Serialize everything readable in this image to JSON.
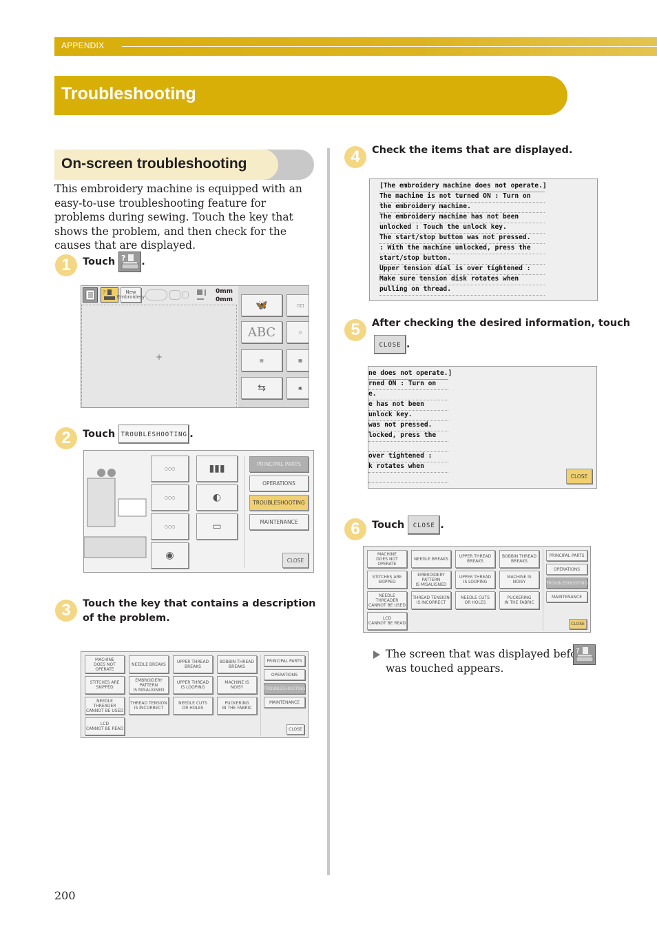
{
  "header": {
    "section_label": "APPENDIX",
    "page_title": "Troubleshooting"
  },
  "section": {
    "heading": "On-screen troubleshooting",
    "intro": "This embroidery machine is equipped with an easy-to-use troubleshooting feature for problems during sewing. Touch the key that shows the problem, and then check for the causes that are displayed."
  },
  "steps": [
    {
      "num": "1",
      "text": "Touch",
      "suffix": ".",
      "icon": "help-machine-icon"
    },
    {
      "num": "2",
      "text": "Touch",
      "button": "TROUBLESHOOTING",
      "suffix": "."
    },
    {
      "num": "3",
      "text": "Touch the key that contains a description of the problem."
    },
    {
      "num": "4",
      "text": "Check the items that are displayed."
    },
    {
      "num": "5",
      "text": "After checking the desired information, touch",
      "button": "CLOSE",
      "suffix": "."
    },
    {
      "num": "6",
      "text": "Touch",
      "button": "CLOSE",
      "suffix": "."
    }
  ],
  "screen1": {
    "new_embroidery": "New\nEmbroidery",
    "size_w": "0mm",
    "size_h": "0mm",
    "abc_label": "ABC"
  },
  "screen2": {
    "side_buttons": [
      "PRINCIPAL PARTS",
      "OPERATIONS",
      "TROUBLESHOOTING",
      "MAINTENANCE"
    ],
    "close": "CLOSE"
  },
  "problem_screen": {
    "keys": [
      "MACHINE\nDOES NOT OPERATE",
      "NEEDLE BREAKS",
      "UPPER THREAD\nBREAKS",
      "BOBBIN THREAD\nBREAKS",
      "STITCHES ARE\nSKIPPED",
      "EMBROIDERY PATTERN\nIS MISALIGNED",
      "UPPER THREAD\nIS LOOPING",
      "MACHINE IS\nNOISY",
      "NEEDLE THREADER\nCANNOT BE USED",
      "THREAD TENSION\nIS INCORRECT",
      "NEEDLE CUTS\nOR HOLES",
      "PUCKERING\nIN THE FABRIC",
      "LCD\nCANNOT BE READ"
    ],
    "side_buttons": [
      "PRINCIPAL PARTS",
      "OPERATIONS",
      "TROUBLESHOOTING",
      "MAINTENANCE"
    ],
    "close": "CLOSE"
  },
  "message_screen": {
    "lines": [
      "[The embroidery machine does not operate.]",
      "The machine is not turned ON : Turn on",
      "the embroidery machine.",
      "The embroidery machine has not been",
      "unlocked : Touch the unlock key.",
      "The start/stop button was not pressed.",
      ": With the machine unlocked, press the",
      "start/stop button.",
      "Upper tension dial is over tightened :",
      "Make sure tension disk rotates when",
      "pulling on thread."
    ],
    "cropped_lines": [
      "ne does not operate.]",
      "rned ON : Turn on",
      "e.",
      "e has not been",
      "unlock key.",
      " was not pressed.",
      "locked, press the",
      "",
      " over tightened :",
      "k rotates when",
      ""
    ],
    "close": "CLOSE"
  },
  "result": {
    "text_before": "The screen that was displayed before",
    "text_after": "was touched appears."
  },
  "footer": {
    "page_number": "200"
  },
  "colors": {
    "accent": "#d8af07",
    "accent_light": "#f6ecc8",
    "step_badge": "#f3d784",
    "grey_cap": "#bcbcbc"
  }
}
